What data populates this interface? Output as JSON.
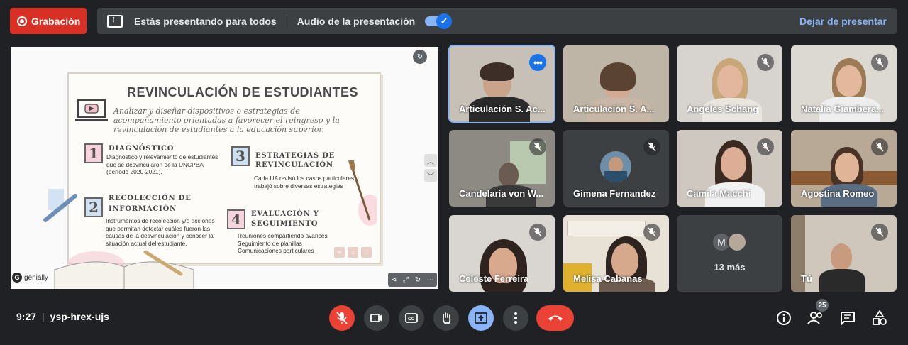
{
  "top_bar": {
    "record_label": "Grabación",
    "presenting_text": "Estás presentando para todos",
    "audio_label": "Audio de la presentación",
    "audio_enabled": true,
    "stop_presenting": "Dejar de presentar"
  },
  "slide": {
    "title": "REVINCULACIÓN DE ESTUDIANTES",
    "subtitle": "Analizar y diseñar dispositivos o estrategias de acompañamiento orientadas a favorecer el reingreso y la revinculación de estudiantes a la educación superior.",
    "steps": [
      {
        "number": "1",
        "title_line1": "DIAGNÓSTICO",
        "title_line2": "",
        "text": "Diagnóstico y relevamiento de estudiantes que se desvincularon de la UNCPBA (período 2020-2021)."
      },
      {
        "number": "2",
        "title_line1": "RECOLECCIÓN DE",
        "title_line2": "INFORMACIÓN",
        "text": "Instrumentos de recolección y/o acciones que permitan detectar cuáles fueron las causas de la desvinculación y conocer la situación actual del estudiante."
      },
      {
        "number": "3",
        "title_line1": "ESTRATEGIAS DE",
        "title_line2": "REVINCULACIÓN",
        "text": "Cada UA revisó los casos particulares y trabajó sobre diversas estrategias"
      },
      {
        "number": "4",
        "title_line1": "EVALUACIÓN Y",
        "title_line2": "SEGUIMIENTO",
        "text": "Reuniones compartiendo avances\nSeguimiento de planillas\nComunicaciones particulares"
      }
    ],
    "brand": "genially"
  },
  "participants": [
    {
      "name": "Articulación S. Ac...",
      "muted": false,
      "active": true
    },
    {
      "name": "Articulación S. A...",
      "muted": false,
      "active": false
    },
    {
      "name": "Angeles Schang",
      "muted": true,
      "active": false
    },
    {
      "name": "Natalia Giambera...",
      "muted": true,
      "active": false
    },
    {
      "name": "Candelaria von W...",
      "muted": true,
      "active": false
    },
    {
      "name": "Gimena Fernandez",
      "muted": true,
      "active": false
    },
    {
      "name": "Camila Macchi",
      "muted": true,
      "active": false
    },
    {
      "name": "Agostina Romeo",
      "muted": true,
      "active": false
    },
    {
      "name": "Celeste Ferreira",
      "muted": true,
      "active": false
    },
    {
      "name": "Melisa Cabanas",
      "muted": true,
      "active": false
    },
    {
      "name": "Tú",
      "muted": true,
      "active": false
    }
  ],
  "more_tile": {
    "label": "13 más",
    "avatar_letter": "M"
  },
  "bottom_bar": {
    "time": "9:27",
    "separator": "|",
    "meeting_code": "ysp-hrex-ujs",
    "participant_count": "25"
  },
  "colors": {
    "accent": "#8ab4f8",
    "danger": "#ea4335",
    "record": "#d93025",
    "background": "#202124"
  }
}
